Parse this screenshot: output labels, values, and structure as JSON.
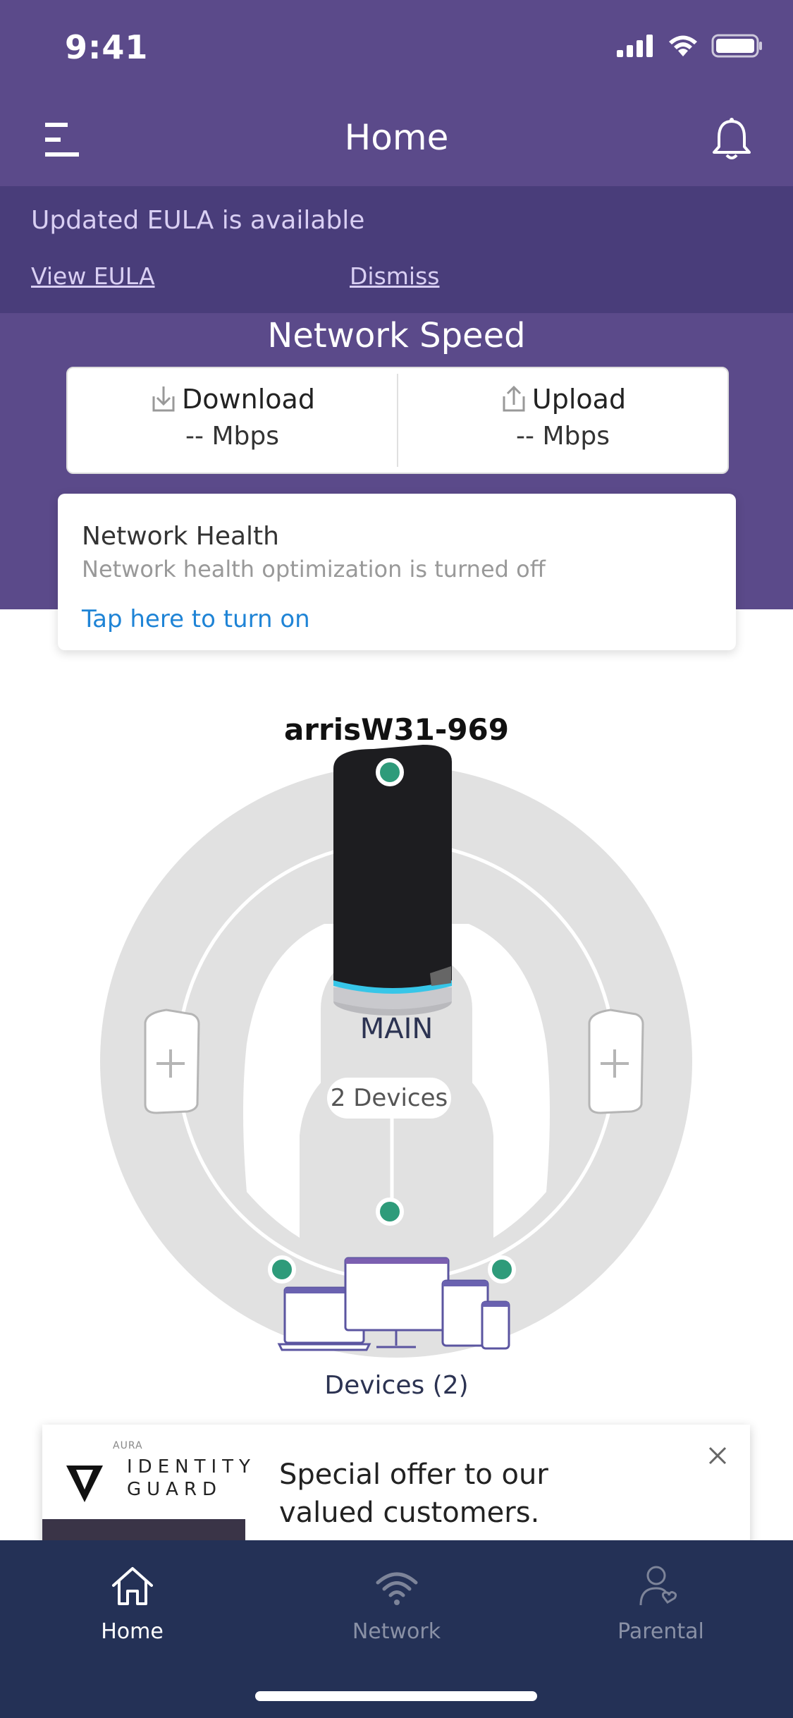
{
  "status": {
    "time": "9:41"
  },
  "header": {
    "title": "Home"
  },
  "eula": {
    "message": "Updated EULA is available",
    "view_label": "View EULA",
    "dismiss_label": "Dismiss"
  },
  "speed": {
    "title": "Network Speed",
    "download_label": "Download",
    "download_value": "-- Mbps",
    "upload_label": "Upload",
    "upload_value": "-- Mbps"
  },
  "health": {
    "title": "Network Health",
    "subtitle": "Network health optimization is turned off",
    "action": "Tap here to turn on"
  },
  "network": {
    "name": "arrisW31-969",
    "router_label": "MAIN",
    "router_devices": "2 Devices",
    "devices_label": "Devices (2)"
  },
  "ad": {
    "brand_small": "AURA",
    "brand_line1": "IDENTITY",
    "brand_line2": "GUARD",
    "message": "Special offer to our valued customers."
  },
  "tabs": [
    {
      "label": "Home",
      "icon": "home-icon",
      "active": true
    },
    {
      "label": "Network",
      "icon": "wifi-icon",
      "active": false
    },
    {
      "label": "Parental",
      "icon": "parental-icon",
      "active": false
    }
  ],
  "colors": {
    "header": "#5b4a8a",
    "eula_bg": "#493d7a",
    "tabbar": "#243156",
    "accent_link": "#1f84d6",
    "node_dot": "#2e9b7a"
  }
}
